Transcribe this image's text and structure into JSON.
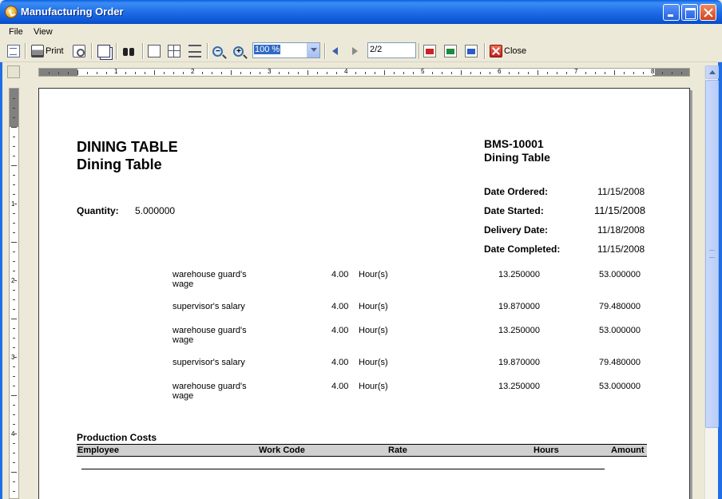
{
  "window": {
    "title": "Manufacturing Order"
  },
  "menu": {
    "file": "File",
    "view": "View"
  },
  "toolbar": {
    "print_label": "Print",
    "zoom_value": "100 %",
    "page_value": "2/2",
    "close_label": "Close"
  },
  "ruler": {
    "h_numbers": [
      "1",
      "2",
      "3",
      "4",
      "5",
      "6",
      "7",
      "8"
    ],
    "v_numbers": [
      "1",
      "2",
      "3",
      "4"
    ]
  },
  "report": {
    "product_code": "DINING TABLE",
    "product_name": "Dining Table",
    "order_number": "BMS-10001",
    "order_product": "Dining Table",
    "quantity_label": "Quantity:",
    "quantity_value": "5.000000",
    "dates": [
      {
        "label": "Date Ordered:",
        "value": "11/15/2008"
      },
      {
        "label": "Date Started:",
        "value": "11/15/2008"
      },
      {
        "label": "Delivery Date:",
        "value": "11/18/2008"
      },
      {
        "label": "Date Completed:",
        "value": "11/15/2008"
      }
    ],
    "lines": [
      {
        "name": "warehouse guard's wage",
        "qty": "4.00",
        "unit": "Hour(s)",
        "rate": "13.250000",
        "amount": "53.000000"
      },
      {
        "name": "supervisor's salary",
        "qty": "4.00",
        "unit": "Hour(s)",
        "rate": "19.870000",
        "amount": "79.480000"
      },
      {
        "name": "warehouse guard's wage",
        "qty": "4.00",
        "unit": "Hour(s)",
        "rate": "13.250000",
        "amount": "53.000000"
      },
      {
        "name": "supervisor's salary",
        "qty": "4.00",
        "unit": "Hour(s)",
        "rate": "19.870000",
        "amount": "79.480000"
      },
      {
        "name": "warehouse guard's wage",
        "qty": "4.00",
        "unit": "Hour(s)",
        "rate": "13.250000",
        "amount": "53.000000"
      }
    ],
    "production_costs_title": "Production Costs",
    "columns": [
      "Employee",
      "Work Code",
      "Rate",
      "Hours",
      "Amount"
    ]
  }
}
